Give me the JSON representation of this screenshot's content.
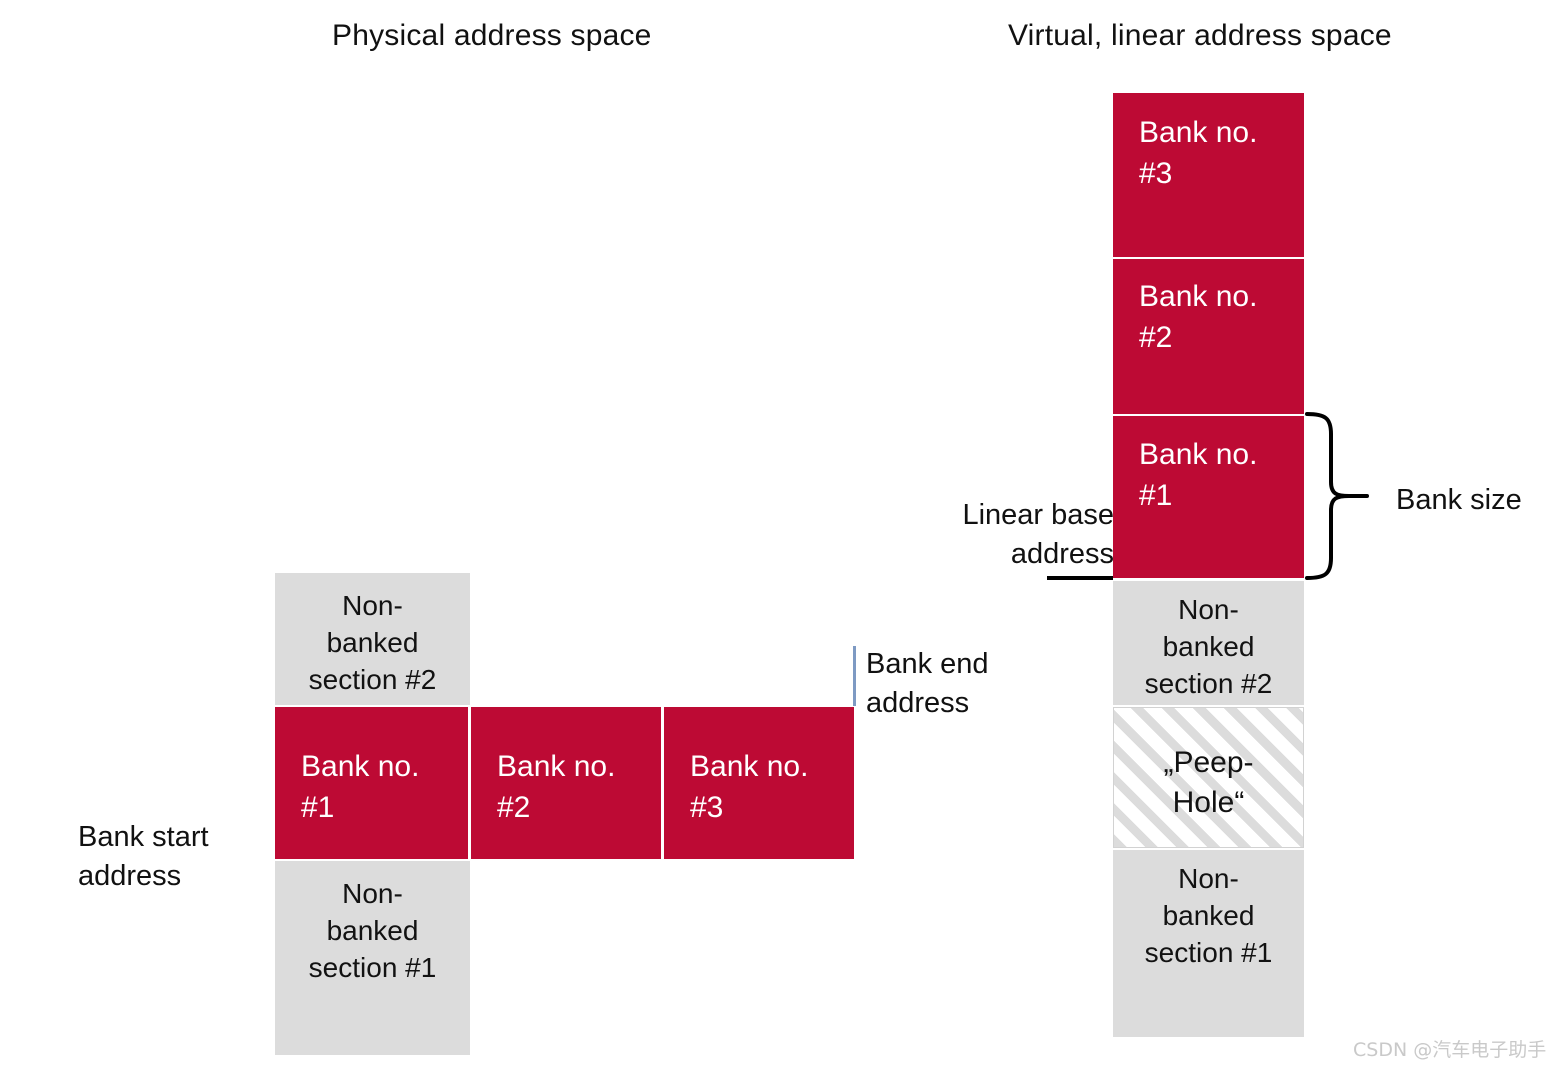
{
  "headings": {
    "physical": "Physical address space",
    "virtual": "Virtual, linear address space"
  },
  "colors": {
    "bank_red": "#bd0a34",
    "section_gray": "#dcdcdc",
    "hatch_gray": "#dcdcdc",
    "leader_blue": "#7e9ac3",
    "text_black": "#111111",
    "watermark_gray": "#c9c9c9"
  },
  "physical": {
    "nonbanked2": "Non-\nbanked\nsection #2",
    "nonbanked1": "Non-\nbanked\nsection #1",
    "banks": [
      {
        "label": "Bank no.\n#1"
      },
      {
        "label": "Bank no.\n#2"
      },
      {
        "label": "Bank no.\n#3"
      }
    ]
  },
  "virtual": {
    "banks": [
      {
        "label": "Bank no.\n#3"
      },
      {
        "label": "Bank no.\n#2"
      },
      {
        "label": "Bank no.\n#1"
      }
    ],
    "nonbanked2": "Non-\nbanked\nsection #2",
    "peephole": "„Peep-\nHole“",
    "nonbanked1": "Non-\nbanked\nsection #1"
  },
  "annotations": {
    "bank_start_address": "Bank start\naddress",
    "bank_end_address": "Bank end\naddress",
    "linear_base_address": "Linear base\naddress",
    "bank_size": "Bank size"
  },
  "watermark": "CSDN @汽车电子助手"
}
